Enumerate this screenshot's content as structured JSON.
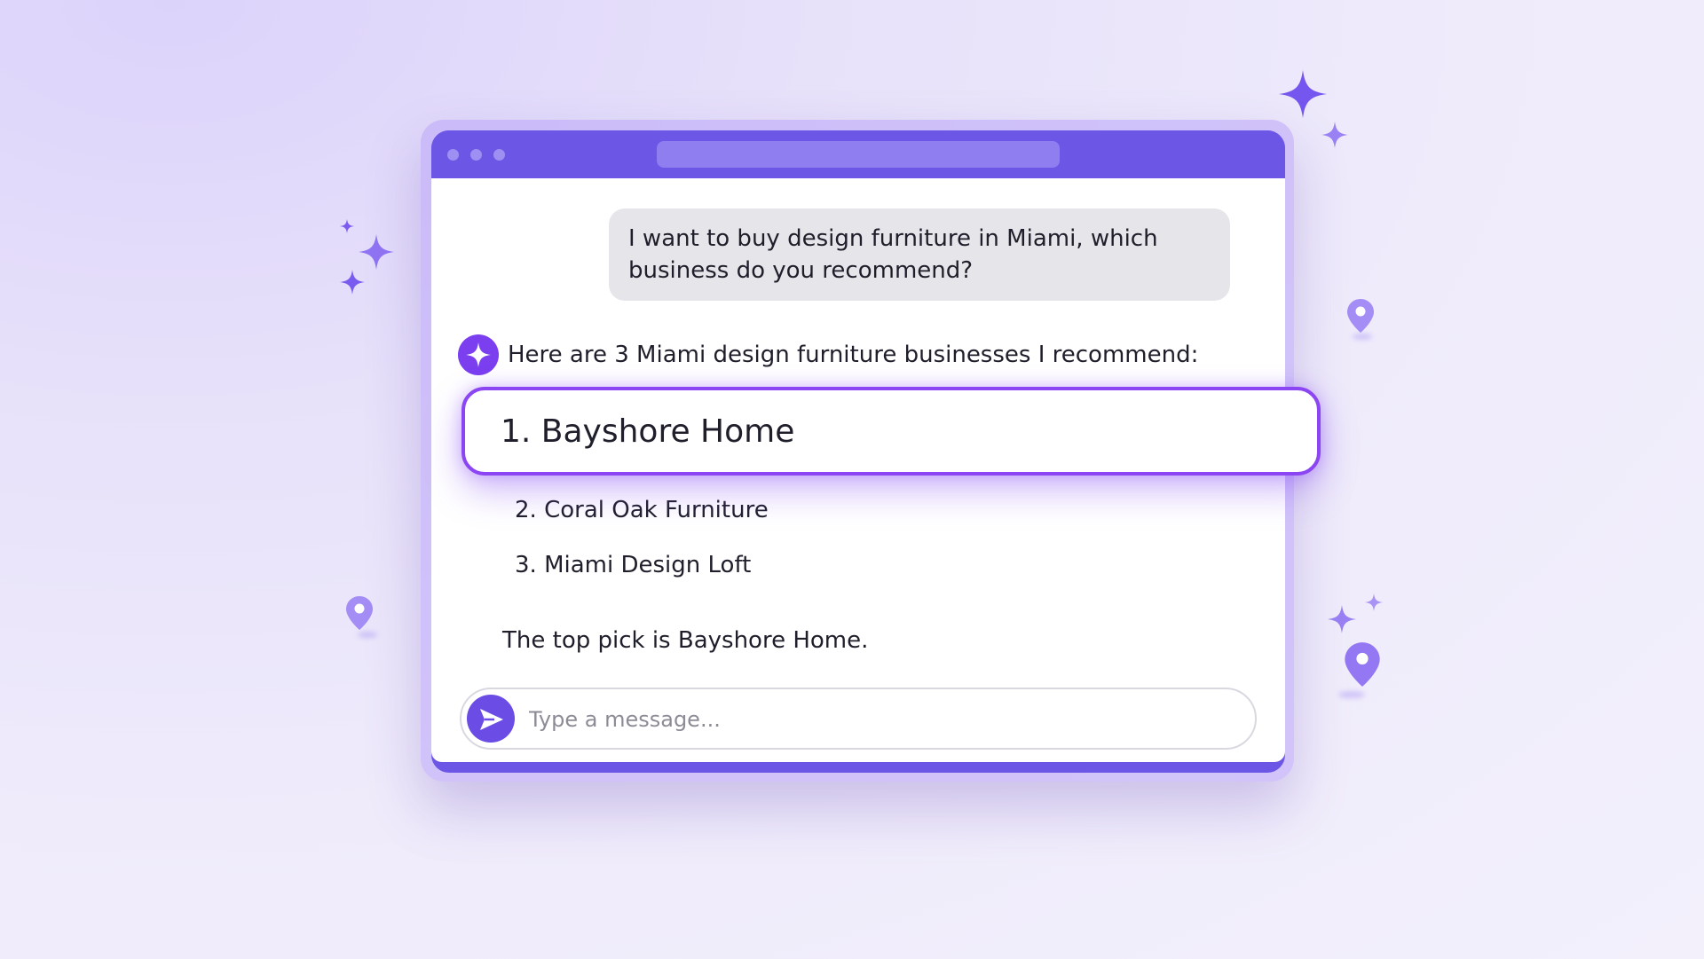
{
  "colors": {
    "accent": "#6b56e6",
    "highlight_border": "#8b45f2",
    "ai_avatar": "#7b3ff0",
    "user_bubble": "#e6e5ea"
  },
  "icons": {
    "ai_avatar": "sparkle-icon",
    "send": "send-icon",
    "decorations": [
      "sparkle-icon",
      "location-pin-icon"
    ]
  },
  "chat": {
    "user_message": "I want to buy design furniture in Miami, which business do you recommend?",
    "ai_intro": "Here are 3 Miami design furniture businesses I recommend:",
    "recommendations": [
      "1. Bayshore Home",
      "2. Coral Oak Furniture",
      "3. Miami Design Loft"
    ],
    "closing": "The top pick is Bayshore Home."
  },
  "composer": {
    "placeholder": "Type a message..."
  }
}
